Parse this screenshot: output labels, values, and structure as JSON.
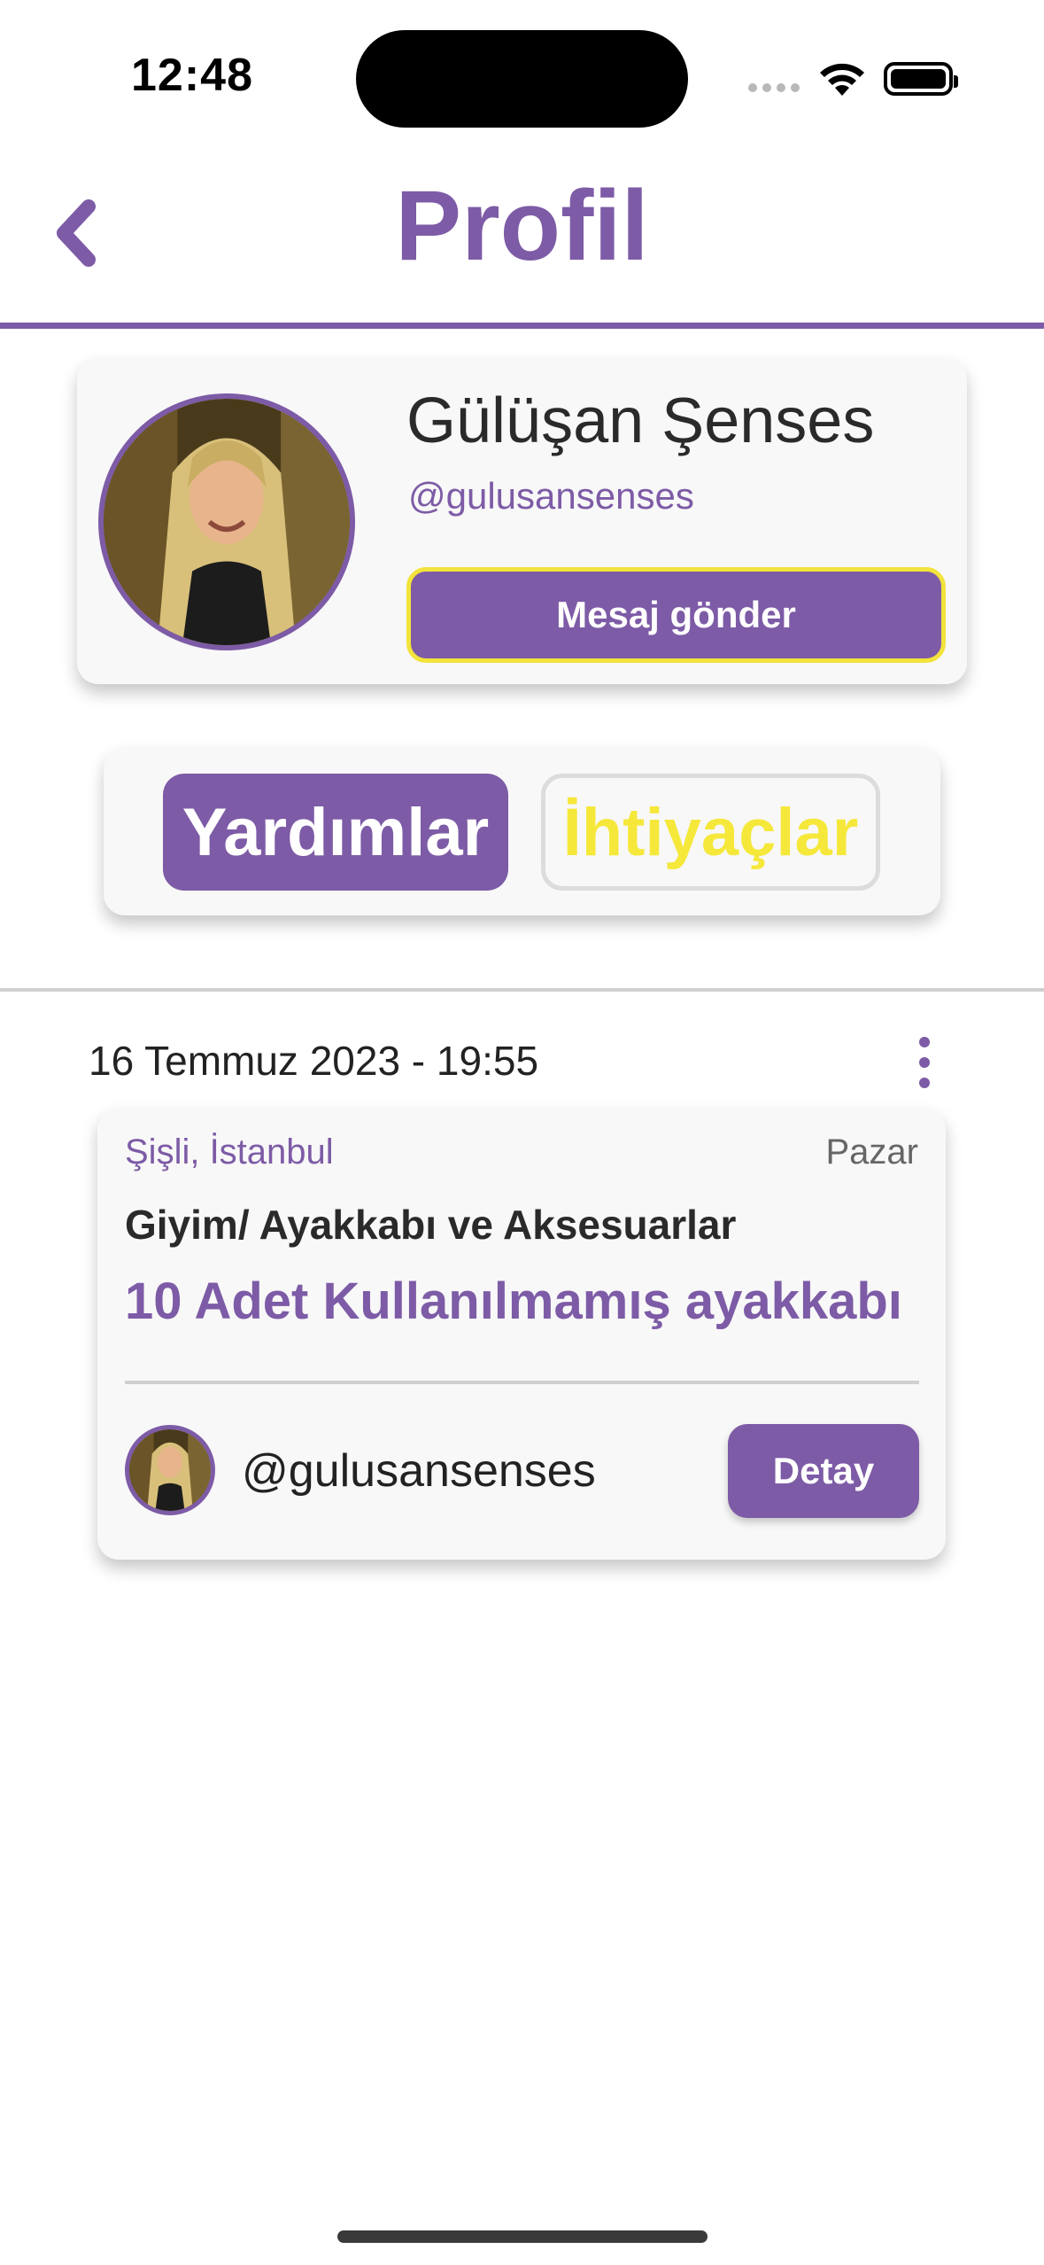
{
  "status_bar": {
    "time": "12:48"
  },
  "header": {
    "back_icon": "chevron-left-icon",
    "title": "Profil"
  },
  "profile": {
    "name": "Gülüşan Şenses",
    "handle": "@gulusansenses",
    "message_label": "Mesaj gönder"
  },
  "tabs": [
    {
      "label": "Yardımlar",
      "active": true
    },
    {
      "label": "İhtiyaçlar",
      "active": false
    }
  ],
  "post": {
    "date": "16 Temmuz 2023 - 19:55",
    "location": "Şişli, İstanbul",
    "day": "Pazar",
    "category": "Giyim/ Ayakkabı ve Aksesuarlar",
    "title": "10 Adet Kullanılmamış ayakkabı",
    "author_handle": "@gulusansenses",
    "detail_label": "Detay"
  },
  "colors": {
    "accent": "#7d5ba6",
    "highlight": "#f5e83a",
    "card": "#f8f8f8"
  }
}
